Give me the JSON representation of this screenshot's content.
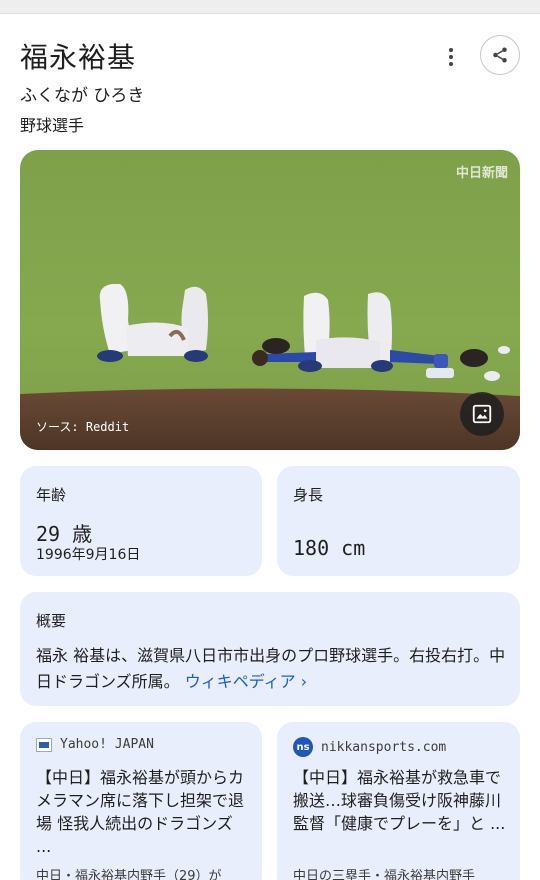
{
  "entity": {
    "name": "福永裕基",
    "reading": "ふくなが ひろき",
    "description": "野球選手"
  },
  "image": {
    "source": "ソース: Reddit",
    "watermark": "中日新聞"
  },
  "facts": {
    "age": {
      "label": "年齢",
      "value": "29 歳",
      "date": "1996年9月16日"
    },
    "height": {
      "label": "身長",
      "value": "180 cm"
    }
  },
  "overview": {
    "label": "概要",
    "text": "福永 裕基は、滋賀県八日市市出身のプロ野球選手。右投右打。中日ドラゴンズ所属。",
    "link": "ウィキペディア ›"
  },
  "news": [
    {
      "source": "Yahoo! JAPAN",
      "title": "【中日】福永裕基が頭からカメラマン席に落下し担架で退場 怪我人続出のドラゴンズ ...",
      "snippet": "中日・福永裕基内野手（29）が"
    },
    {
      "source": "nikkansports.com",
      "favicon_text": "ns",
      "title": "【中日】福永裕基が救急車で搬送…球審負傷受け阪神藤川監督「健康でプレーを」と ...",
      "snippet": "中日の三塁手・福永裕基内野手"
    }
  ],
  "colors": {
    "card_bg": "#e8eefb",
    "link": "#1a5dcf"
  }
}
